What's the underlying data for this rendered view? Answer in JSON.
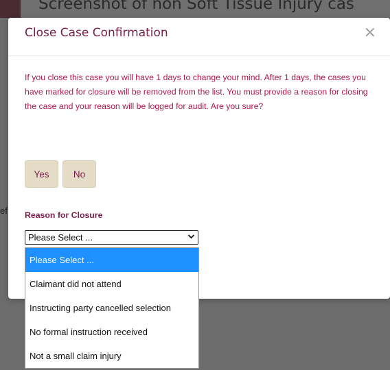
{
  "background": {
    "title_fragment": "Screenshot of non Soft Tissue Injury cas",
    "left_fragment": "ef"
  },
  "modal": {
    "title": "Close Case Confirmation",
    "close_glyph": "×",
    "message": "If you close this case you will have 1 days to change your mind. After 1 days, the cases you have marked for closure will be removed from the list. You must provide a reason for closing the case and your reason will be logged for audit. Are you sure?",
    "yes_label": "Yes",
    "no_label": "No",
    "reason_label": "Reason for Closure",
    "select": {
      "value": "Please Select ...",
      "options": [
        "Please Select ...",
        "Claimant did not attend",
        "Instructing party cancelled selection",
        "No formal instruction received",
        "Not a small claim injury"
      ],
      "selected_index": 0
    }
  },
  "colors": {
    "accent": "#7a1e4c",
    "message_text": "#b0174d",
    "button_bg": "#e4dcc6",
    "option_selected_bg": "#1e90ff"
  }
}
